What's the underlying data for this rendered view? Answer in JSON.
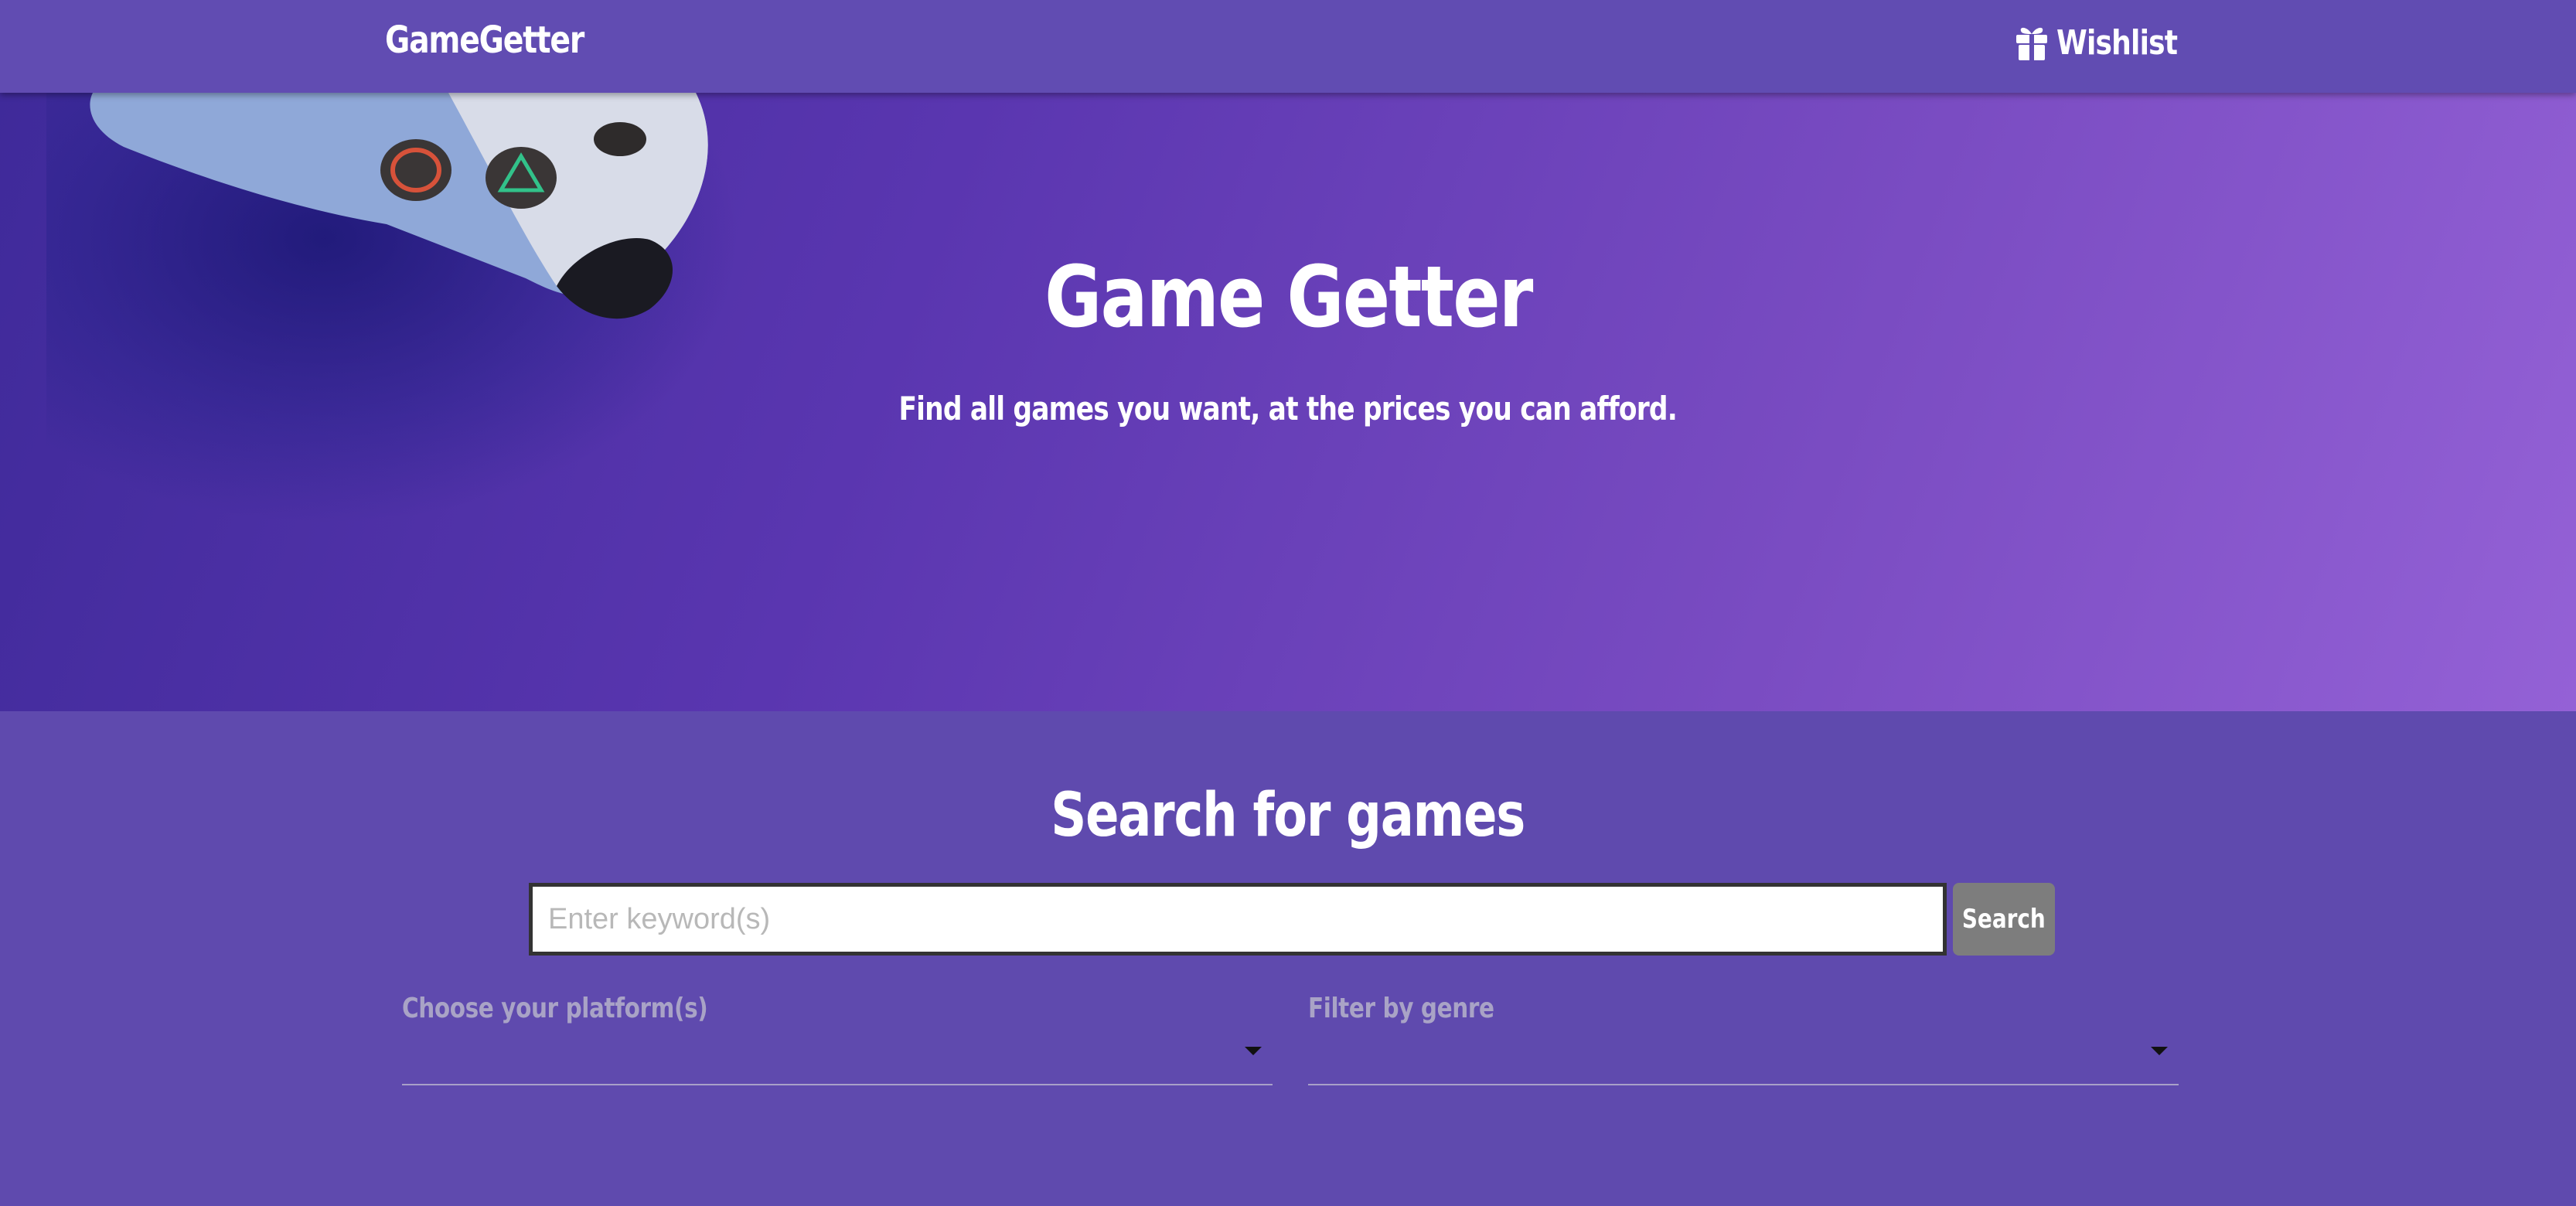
{
  "navbar": {
    "brand": "GameGetter",
    "wishlist_label": "Wishlist",
    "wishlist_icon": "gift-icon"
  },
  "hero": {
    "title": "Game Getter",
    "subtitle": "Find all games you want, at the prices you can afford."
  },
  "search": {
    "title": "Search for games",
    "input_placeholder": "Enter keyword(s)",
    "input_value": "",
    "button_label": "Search"
  },
  "filters": {
    "platform_label": "Choose your platform(s)",
    "genre_label": "Filter by genre"
  },
  "colors": {
    "navbar": "#614cb2",
    "section_bg": "#5f4aae",
    "button": "#7d7d7d"
  }
}
